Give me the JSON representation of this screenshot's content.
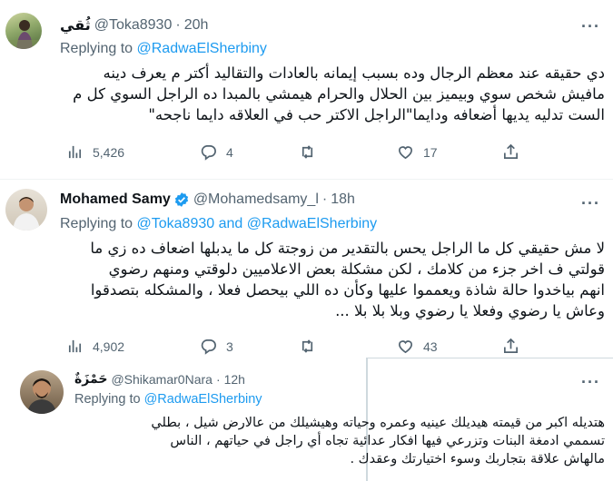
{
  "tweets": [
    {
      "name": "ثُقي",
      "handle": "@Toka8930",
      "time": "20h",
      "reply_prefix": "Replying to",
      "reply_mentions": "@RadwaElSherbiny",
      "lines": [
        "دي حقيقه عند معظم الرجال وده بسبب إيمانه بالعادات والتقاليد أكتر م يعرف دينه",
        "مافيش شخص سوي وبيميز بين الحلال والحرام هيمشي بالمبدا ده الراجل السوي كل م",
        "الست تدليه يديها أضعافه ودايما\"الراجل الاكتر حب في العلاقه دايما ناجحه\""
      ],
      "views": "5,426",
      "replies": "4",
      "retweets": "",
      "likes": "17"
    },
    {
      "name": "Mohamed Samy",
      "handle": "@Mohamedsamy_l",
      "time": "18h",
      "reply_prefix": "Replying to",
      "reply_mentions": "@Toka8930 and @RadwaElSherbiny",
      "lines": [
        "لا مش حقيقي كل ما الراجل يحس بالتقدير من زوجتة كل ما يدبلها اضعاف ده زي ما",
        "قولتي ف اخر جزء من كلامك ، لكن مشكلة بعض الاعلاميين دلوقتي ومنهم رضوي",
        "انهم بياخدوا حالة شاذة ويعمموا عليها وكأن ده اللي بيحصل فعلا ، والمشكله بتصدقوا",
        "وعاش يا رضوي وفعلا يا رضوي وبلا بلا بلا ..."
      ],
      "views": "4,902",
      "replies": "3",
      "retweets": "",
      "likes": "43"
    },
    {
      "name": "حَمْزَةٌ",
      "handle": "@Shikamar0Nara",
      "time": "12h",
      "reply_prefix": "Replying to",
      "reply_mentions": "@RadwaElSherbiny",
      "lines": [
        "هتديله اكبر من قيمته هيديلك عينيه وعمره وحياته وهيشيلك من عالارض شيل ، بطلي",
        "تسممي ادمغة البنات وتزرعي فيها افكار عدائية تجاه أي راجل في حياتهم ، الناس",
        "مالهاش علاقة بتجاربك وسوء اختيارتك وعقدك ."
      ]
    }
  ],
  "colors": {
    "accent": "#1d9bf0",
    "secondary_text": "#536471",
    "primary_text": "#0f1419"
  }
}
